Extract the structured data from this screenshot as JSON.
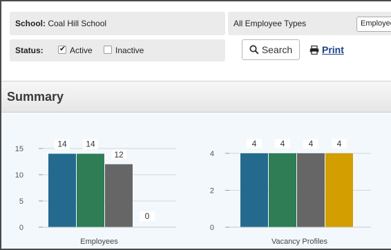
{
  "filters": {
    "school_label": "School:",
    "school_value": "Coal Hill School",
    "status_label": "Status:",
    "active_label": "Active",
    "active_checked": true,
    "inactive_label": "Inactive",
    "inactive_checked": false,
    "employee_types_label": "All Employee Types",
    "employee_select_value": "Employee"
  },
  "toolbar": {
    "search_label": "Search",
    "print_label": "Print"
  },
  "summary": {
    "title": "Summary"
  },
  "chart_data": [
    {
      "type": "bar",
      "title": "",
      "xlabel": "Employees",
      "ylabel": "",
      "ylim": [
        0,
        15
      ],
      "yticks": [
        0,
        5,
        10,
        15
      ],
      "values": [
        14,
        14,
        12,
        0
      ],
      "colors": [
        "#246a8f",
        "#2e7d55",
        "#666666",
        "#d39e00"
      ],
      "grid": true
    },
    {
      "type": "bar",
      "title": "",
      "xlabel": "Vacancy Profiles",
      "ylabel": "",
      "ylim": [
        0,
        4
      ],
      "yticks": [
        0,
        2,
        4
      ],
      "values": [
        4,
        4,
        4,
        4
      ],
      "colors": [
        "#246a8f",
        "#2e7d55",
        "#666666",
        "#d39e00"
      ],
      "grid": true
    }
  ]
}
